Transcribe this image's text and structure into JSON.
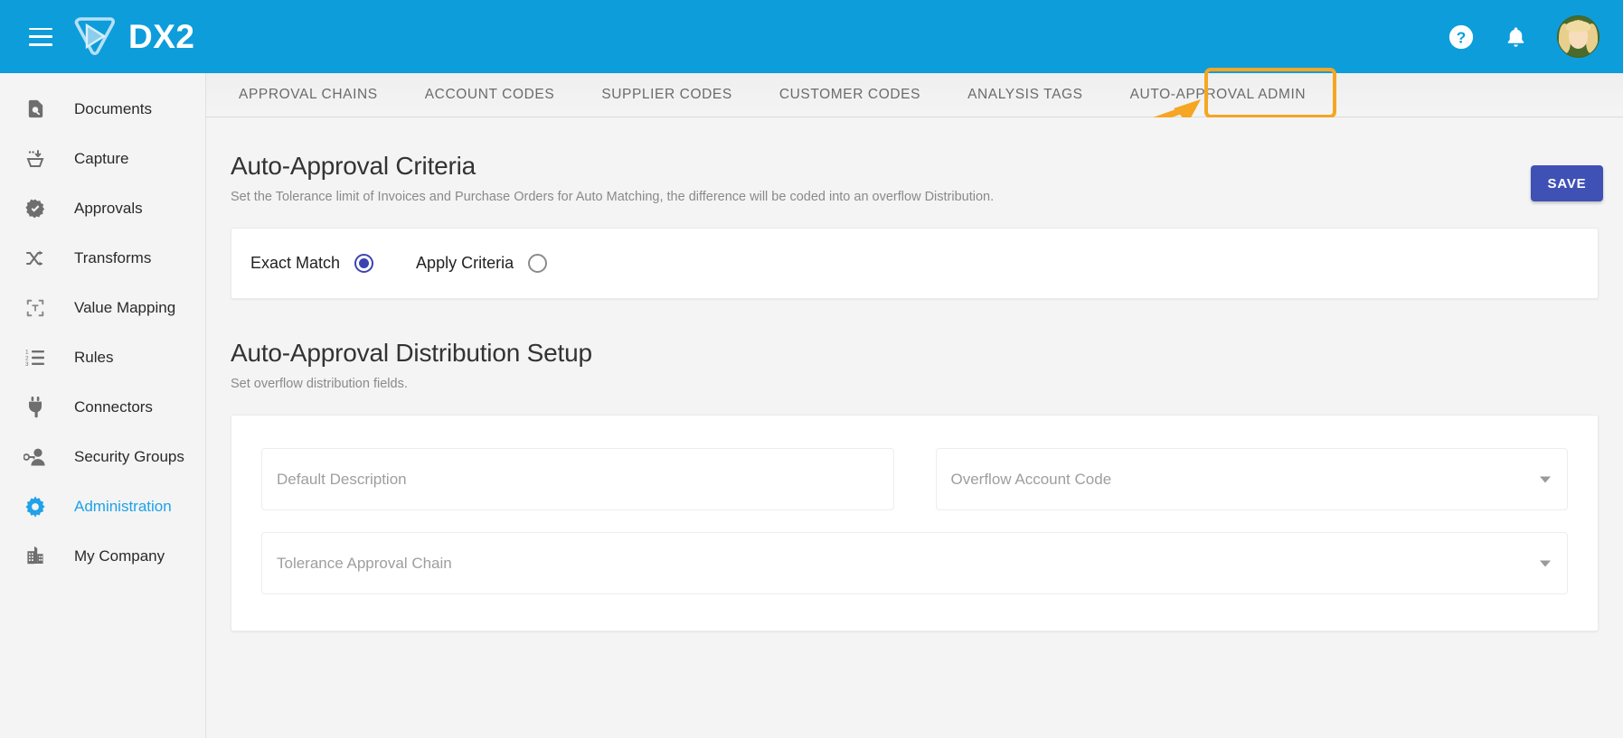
{
  "topbar": {
    "menu_icon": "hamburger-icon",
    "brand": "DX2",
    "help_icon": "help-circle-icon",
    "notifications_icon": "bell-icon",
    "avatar": "user-avatar"
  },
  "sidebar": {
    "items": [
      {
        "label": "Documents",
        "icon": "document-search-icon",
        "active": false
      },
      {
        "label": "Capture",
        "icon": "capture-inbox-icon",
        "active": false
      },
      {
        "label": "Approvals",
        "icon": "check-badge-icon",
        "active": false
      },
      {
        "label": "Transforms",
        "icon": "shuffle-icon",
        "active": false
      },
      {
        "label": "Value Mapping",
        "icon": "collapse-arrows-icon",
        "active": false
      },
      {
        "label": "Rules",
        "icon": "numbered-list-icon",
        "active": false
      },
      {
        "label": "Connectors",
        "icon": "power-plug-icon",
        "active": false
      },
      {
        "label": "Security Groups",
        "icon": "user-key-icon",
        "active": false
      },
      {
        "label": "Administration",
        "icon": "gear-icon",
        "active": true
      },
      {
        "label": "My Company",
        "icon": "building-icon",
        "active": false
      }
    ]
  },
  "tabs": [
    {
      "label": "APPROVAL CHAINS",
      "selected": false
    },
    {
      "label": "ACCOUNT CODES",
      "selected": false
    },
    {
      "label": "SUPPLIER CODES",
      "selected": false
    },
    {
      "label": "CUSTOMER CODES",
      "selected": false
    },
    {
      "label": "ANALYSIS TAGS",
      "selected": false
    },
    {
      "label": "AUTO-APPROVAL ADMIN",
      "selected": true
    }
  ],
  "annotation": {
    "highlight_color": "#f5a623",
    "target_tab": "AUTO-APPROVAL ADMIN",
    "arrow": "orange-arrow-pointing-to-tab"
  },
  "criteria_section": {
    "title": "Auto-Approval Criteria",
    "subtitle": "Set the Tolerance limit of Invoices and Purchase Orders for Auto Matching, the difference will be coded into an overflow Distribution.",
    "save_label": "SAVE",
    "save_color": "#3f51b5",
    "options": [
      {
        "label": "Exact Match",
        "checked": true
      },
      {
        "label": "Apply Criteria",
        "checked": false
      }
    ]
  },
  "distribution_section": {
    "title": "Auto-Approval Distribution Setup",
    "subtitle": "Set overflow distribution fields.",
    "fields": [
      {
        "name": "default-description",
        "placeholder": "Default Description",
        "value": "",
        "type": "text"
      },
      {
        "name": "overflow-account-code",
        "placeholder": "Overflow Account Code",
        "value": "",
        "type": "select"
      },
      {
        "name": "tolerance-approval-chain",
        "placeholder": "Tolerance Approval Chain",
        "value": "",
        "type": "select"
      }
    ]
  },
  "colors": {
    "header_blue": "#0d9ddb",
    "accent_link": "#1fa2e8",
    "highlight_orange": "#f5a623",
    "primary_button": "#3f51b5"
  }
}
